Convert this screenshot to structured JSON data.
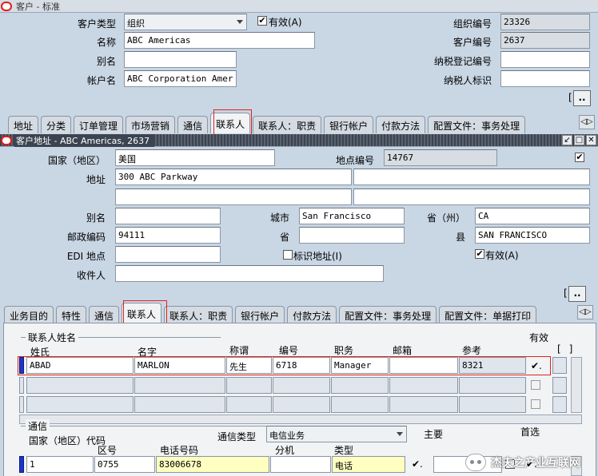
{
  "customer_window": {
    "title": "客户 - 标准",
    "fields": {
      "customer_type_label": "客户类型",
      "customer_type_value": "组织",
      "active_label": "有效(A)",
      "org_number_label": "组织编号",
      "org_number_value": "23326",
      "name_label": "名称",
      "name_value": "ABC Americas",
      "customer_number_label": "客户编号",
      "customer_number_value": "2637",
      "alias_label": "别名",
      "alias_value": "",
      "taxpayer_reg_label": "纳税登记编号",
      "taxpayer_reg_value": "",
      "account_name_label": "帐户名",
      "account_name_value": "ABC Corporation Amer",
      "taxpayer_id_label": "纳税人标识",
      "taxpayer_id_value": ""
    },
    "more_button": "..",
    "tabs": [
      "地址",
      "分类",
      "订单管理",
      "市场营销",
      "通信",
      "联系人",
      "联系人：职责",
      "银行帐户",
      "付款方法",
      "配置文件：事务处理"
    ],
    "tab_arrow": "◁▷"
  },
  "address_window": {
    "title": "客户地址 - ABC Americas, 2637",
    "fields": {
      "country_label": "国家（地区）",
      "country_value": "美国",
      "site_number_label": "地点编号",
      "site_number_value": "14767",
      "address_label": "地址",
      "address_line1": "300 ABC Parkway",
      "alias_label": "别名",
      "city_label": "城市",
      "city_value": "San Francisco",
      "state_label": "省（州）",
      "state_value": "CA",
      "postal_label": "邮政编码",
      "postal_value": "94111",
      "province_label": "省",
      "province_value": "",
      "county_label": "县",
      "county_value": "SAN FRANCISCO",
      "edi_label": "EDI 地点",
      "identify_label": "标识地址(I)",
      "active_label": "有效(A)",
      "recipient_label": "收件人"
    },
    "more_button": "..",
    "tabs": [
      "业务目的",
      "特性",
      "通信",
      "联系人",
      "联系人：职责",
      "银行帐户",
      "付款方法",
      "配置文件：事务处理",
      "配置文件：单据打印"
    ],
    "tab_arrow": "◁▷"
  },
  "contacts": {
    "group_title": "联系人姓名",
    "columns": [
      "姓氏",
      "名字",
      "称谓",
      "编号",
      "职务",
      "邮箱",
      "参考",
      "有效"
    ],
    "rows": [
      {
        "last": "ABAD",
        "first": "MARLON",
        "title": "先生",
        "number": "6718",
        "job": "Manager",
        "mail": "",
        "ref": "8321",
        "active": "✔."
      }
    ]
  },
  "communication": {
    "group_title": "通信",
    "comm_type_label": "通信类型",
    "comm_type_value": "电信业务",
    "columns": [
      "国家（地区）代码",
      "区号",
      "电话号码",
      "分机",
      "类型",
      "主要",
      "首选"
    ],
    "row": {
      "country_code": "1",
      "area": "0755",
      "phone": "83006678",
      "ext": "",
      "type": "电话",
      "primary": "✔.",
      "preferred": "✔."
    }
  },
  "watermark": "杰夫之产业互联网"
}
